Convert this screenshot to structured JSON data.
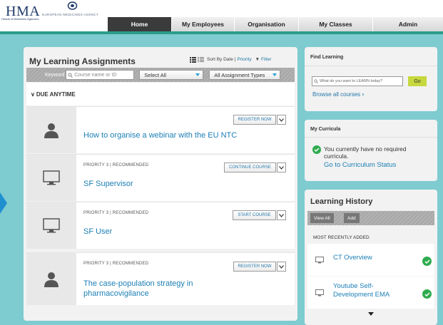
{
  "brand": {
    "logo_text": "HMA",
    "logo_subtitle": "Heads of Medicines Agencies",
    "partner_text": "EUROPEAN MEDICINES AGENCY"
  },
  "nav": {
    "items": [
      {
        "label": "Home",
        "active": true
      },
      {
        "label": "My Employees",
        "active": false
      },
      {
        "label": "Organisation",
        "active": false
      },
      {
        "label": "My Classes",
        "active": false
      },
      {
        "label": "Admin",
        "active": false
      }
    ]
  },
  "assignments": {
    "title": "My Learning Assignments",
    "sort_prefix": "Sort By Date |",
    "sort_priority": "Priority",
    "filter_label": "Filter",
    "keyword_label": "Keyword",
    "keyword_placeholder": "Course name or ID",
    "select_all": "Select All",
    "assignment_types": "All Assignment Types",
    "due_group": "DUE ANYTIME",
    "items": [
      {
        "meta": "",
        "title": "How to organise a webinar with the EU NTC",
        "button": "REGISTER NOW",
        "icon": "person-icon"
      },
      {
        "meta": "PRIORITY 3  |  RECOMMENDED",
        "title": "SF Supervisor",
        "button": "CONTINUE COURSE",
        "icon": "monitor-icon"
      },
      {
        "meta": "PRIORITY 3  |  RECOMMENDED",
        "title": "SF User",
        "button": "START COURSE",
        "icon": "monitor-icon"
      },
      {
        "meta": "PRIORITY 3  |  RECOMMENDED",
        "title_line1": "The case-population strategy in",
        "title_line2": "pharmacovigilance",
        "button": "REGISTER NOW",
        "icon": "person-icon"
      }
    ]
  },
  "find_learning": {
    "title": "Find Learning",
    "search_placeholder": "What do you want to LEARN today?",
    "go_label": "Go",
    "browse_label": "Browse all courses"
  },
  "curricula": {
    "title": "My Curricula",
    "message_line1": "You currently have no required",
    "message_line2": "curricula.",
    "link": "Go to Curriculum Status"
  },
  "history": {
    "title": "Learning History",
    "view_all": "View All",
    "add": "Add",
    "section_label": "MOST RECENTLY ADDED",
    "items": [
      {
        "title_line1": "CT Overview",
        "title_line2": ""
      },
      {
        "title_line1": "Youtube Self-",
        "title_line2": "Development EMA"
      }
    ]
  },
  "colors": {
    "page_bg": "#7ecbd0",
    "accent": "#2d9c8b",
    "link": "#1c7fb5",
    "go_button": "#c6d83d",
    "check": "#2eab4e"
  }
}
